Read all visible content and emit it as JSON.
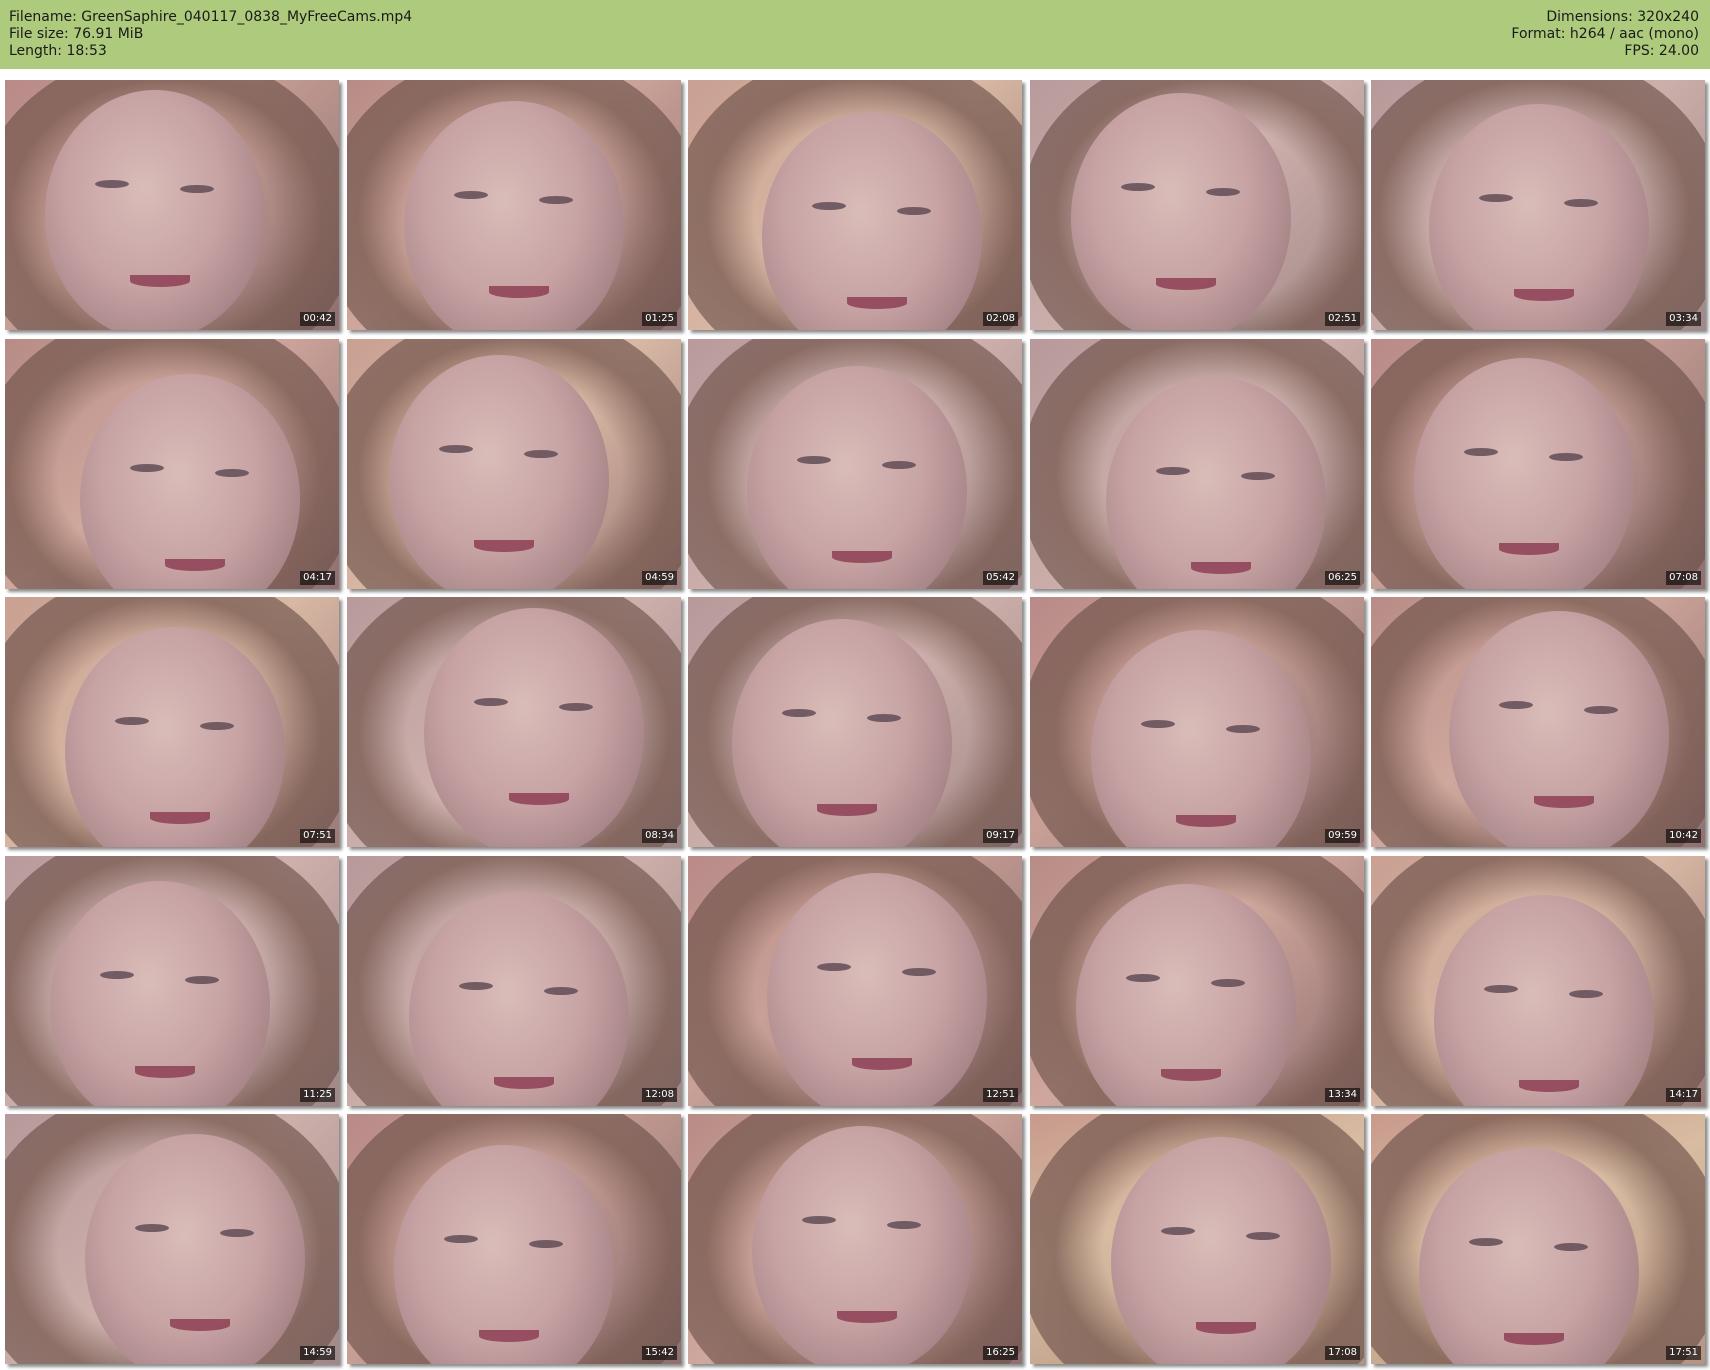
{
  "header": {
    "filename_line": "Filename: GreenSaphire_040117_0838_MyFreeCams.mp4",
    "filesize_line": "File size: 76.91 MiB",
    "length_line": "Length: 18:53",
    "dimensions_line": "Dimensions: 320x240",
    "format_line": "Format: h264 / aac (mono)",
    "fps_line": "FPS: 24.00"
  },
  "colors": {
    "header_bg": "#aecb7d",
    "timestamp_bg": "#000000",
    "timestamp_fg": "#ffffff"
  },
  "thumbnails": [
    {
      "time": "00:42"
    },
    {
      "time": "01:25"
    },
    {
      "time": "02:08"
    },
    {
      "time": "02:51"
    },
    {
      "time": "03:34"
    },
    {
      "time": "04:17"
    },
    {
      "time": "04:59"
    },
    {
      "time": "05:42"
    },
    {
      "time": "06:25"
    },
    {
      "time": "07:08"
    },
    {
      "time": "07:51"
    },
    {
      "time": "08:34"
    },
    {
      "time": "09:17"
    },
    {
      "time": "09:59"
    },
    {
      "time": "10:42"
    },
    {
      "time": "11:25"
    },
    {
      "time": "12:08"
    },
    {
      "time": "12:51"
    },
    {
      "time": "13:34"
    },
    {
      "time": "14:17"
    },
    {
      "time": "14:59"
    },
    {
      "time": "15:42"
    },
    {
      "time": "16:25"
    },
    {
      "time": "17:08"
    },
    {
      "time": "17:51"
    }
  ]
}
